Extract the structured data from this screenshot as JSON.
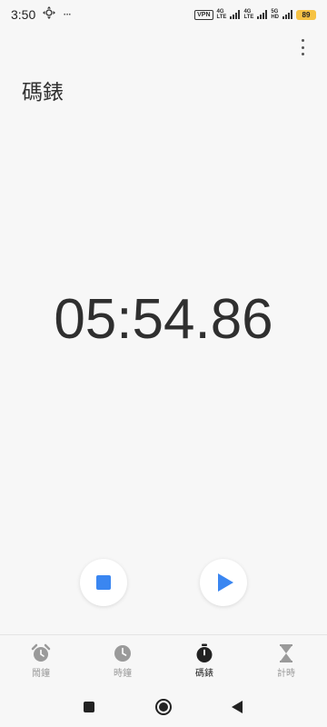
{
  "status_bar": {
    "time": "3:50",
    "move_icon": "move-arrows-icon",
    "more_dots": "···",
    "vpn_label": "VPN",
    "net_badge_1": "4G",
    "net_badge_1_sub": "LTE",
    "net_badge_2": "4G",
    "net_badge_2_sub": "LTE",
    "net_badge_3": "5G",
    "net_badge_3_sub": "HD",
    "battery": "89"
  },
  "header": {
    "title": "碼錶",
    "menu_icon": "more-vert-icon"
  },
  "stopwatch": {
    "elapsed": "05:54.86"
  },
  "controls": {
    "stop_icon": "stop-icon",
    "play_icon": "play-icon",
    "accent_color": "#3a86f1"
  },
  "bottom_nav": {
    "items": [
      {
        "label": "鬧鐘",
        "icon": "alarm-clock-icon",
        "active": false
      },
      {
        "label": "時鐘",
        "icon": "clock-icon",
        "active": false
      },
      {
        "label": "碼錶",
        "icon": "stopwatch-icon",
        "active": true
      },
      {
        "label": "計時",
        "icon": "hourglass-icon",
        "active": false
      }
    ]
  },
  "system_nav": {
    "recent": "recent-apps-icon",
    "home": "home-icon",
    "back": "back-icon"
  }
}
